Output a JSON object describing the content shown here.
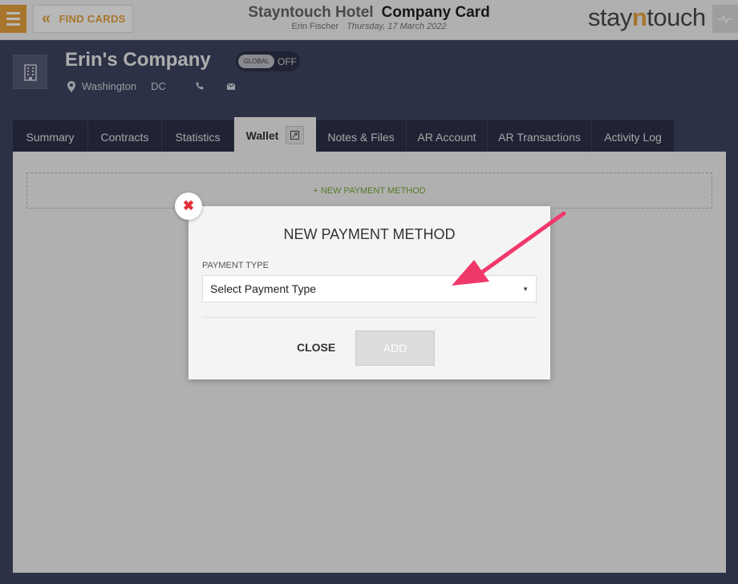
{
  "header": {
    "find_cards": "FIND CARDS",
    "hotel_name": "Stayntouch Hotel",
    "page_title": "Company Card",
    "user": "Erin Fischer",
    "date": "Thursday, 17 March 2022",
    "logo": {
      "pre": "stay",
      "accent": "n",
      "post": "touch"
    }
  },
  "company": {
    "name": "Erin's Company",
    "toggle_label": "GLOBAL",
    "toggle_state": "OFF",
    "city": "Washington",
    "state": "DC"
  },
  "tabs": [
    {
      "label": "Summary",
      "active": false
    },
    {
      "label": "Contracts",
      "active": false
    },
    {
      "label": "Statistics",
      "active": false
    },
    {
      "label": "Wallet",
      "active": true
    },
    {
      "label": "Notes & Files",
      "active": false
    },
    {
      "label": "AR Account",
      "active": false
    },
    {
      "label": "AR Transactions",
      "active": false
    },
    {
      "label": "Activity Log",
      "active": false
    }
  ],
  "wallet": {
    "new_payment_link": "+ NEW PAYMENT METHOD"
  },
  "modal": {
    "title": "NEW PAYMENT METHOD",
    "payment_type_label": "PAYMENT TYPE",
    "payment_type_value": "Select Payment Type",
    "close": "CLOSE",
    "add": "ADD"
  },
  "colors": {
    "accent": "#e8a33c",
    "nav_dark": "#2c3148",
    "annotation_arrow": "#f0386b"
  }
}
